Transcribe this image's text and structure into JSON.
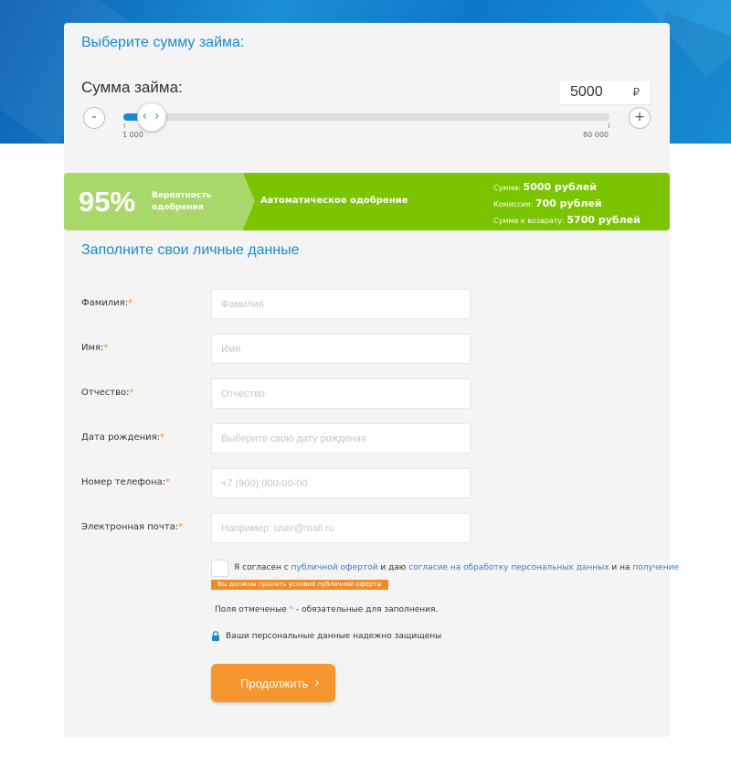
{
  "loan": {
    "title": "Выберите сумму займа:",
    "amount_label": "Сумма займа:",
    "amount_value": "5000",
    "currency": "₽",
    "minus_label": "-",
    "plus_label": "+",
    "slider_handle": "‹ ›",
    "slider_min_label": "1 000",
    "slider_max_label": "80 000",
    "slider_fraction": 0.05
  },
  "approval": {
    "percent": "95%",
    "probability_label": "Вероятность одобрения",
    "auto_label": "Автоматическое одобрение",
    "sum_label": "Сумма:",
    "sum_value": "5000 рублей",
    "commission_label": "Комиссия:",
    "commission_value": "700 рублей",
    "return_label": "Сумма к возврату:",
    "return_value": "5700 рублей"
  },
  "form": {
    "title": "Заполните свои личные данные",
    "required_mark": "*",
    "fields": [
      {
        "label": "Фамилия:",
        "placeholder": "Фамилия",
        "value": ""
      },
      {
        "label": "Имя:",
        "placeholder": "Имя",
        "value": ""
      },
      {
        "label": "Отчество:",
        "placeholder": "Отчество",
        "value": ""
      },
      {
        "label": "Дата рождения:",
        "placeholder": "Выберите свою дату рождения",
        "value": ""
      },
      {
        "label": "Номер телефона:",
        "placeholder": "+7 (900) 000-00-00",
        "value": ""
      },
      {
        "label": "Электронная почта:",
        "placeholder": "Например: user@mail.ru",
        "value": ""
      }
    ],
    "consent": {
      "text1": "Я согласен с",
      "link1": "публичной офертой",
      "text2": "и даю",
      "link2": "согласие на обработку персональных данных",
      "text3": "и на",
      "link3": "получение"
    },
    "warning": "Вы должны принять условия публичной оферты",
    "note_before": "Поля отмеченые",
    "note_after": "- обязательные для заполнения.",
    "secure_text": "Ваши персональные данные надежно защищены",
    "submit_label": "Продолжить"
  },
  "colors": {
    "accent_blue": "#1a8ad0",
    "green": "#7bc400",
    "light_green": "#a9d86a",
    "orange": "#f5962e"
  }
}
